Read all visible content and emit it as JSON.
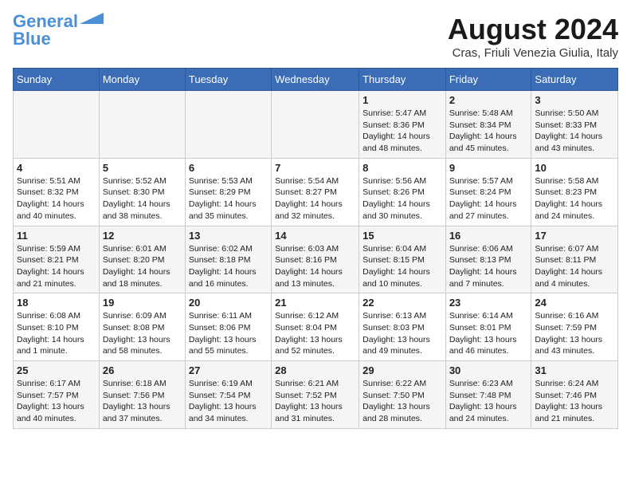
{
  "header": {
    "logo_line1": "General",
    "logo_line2": "Blue",
    "month_title": "August 2024",
    "location": "Cras, Friuli Venezia Giulia, Italy"
  },
  "days_of_week": [
    "Sunday",
    "Monday",
    "Tuesday",
    "Wednesday",
    "Thursday",
    "Friday",
    "Saturday"
  ],
  "weeks": [
    [
      {
        "day": "",
        "info": ""
      },
      {
        "day": "",
        "info": ""
      },
      {
        "day": "",
        "info": ""
      },
      {
        "day": "",
        "info": ""
      },
      {
        "day": "1",
        "info": "Sunrise: 5:47 AM\nSunset: 8:36 PM\nDaylight: 14 hours\nand 48 minutes."
      },
      {
        "day": "2",
        "info": "Sunrise: 5:48 AM\nSunset: 8:34 PM\nDaylight: 14 hours\nand 45 minutes."
      },
      {
        "day": "3",
        "info": "Sunrise: 5:50 AM\nSunset: 8:33 PM\nDaylight: 14 hours\nand 43 minutes."
      }
    ],
    [
      {
        "day": "4",
        "info": "Sunrise: 5:51 AM\nSunset: 8:32 PM\nDaylight: 14 hours\nand 40 minutes."
      },
      {
        "day": "5",
        "info": "Sunrise: 5:52 AM\nSunset: 8:30 PM\nDaylight: 14 hours\nand 38 minutes."
      },
      {
        "day": "6",
        "info": "Sunrise: 5:53 AM\nSunset: 8:29 PM\nDaylight: 14 hours\nand 35 minutes."
      },
      {
        "day": "7",
        "info": "Sunrise: 5:54 AM\nSunset: 8:27 PM\nDaylight: 14 hours\nand 32 minutes."
      },
      {
        "day": "8",
        "info": "Sunrise: 5:56 AM\nSunset: 8:26 PM\nDaylight: 14 hours\nand 30 minutes."
      },
      {
        "day": "9",
        "info": "Sunrise: 5:57 AM\nSunset: 8:24 PM\nDaylight: 14 hours\nand 27 minutes."
      },
      {
        "day": "10",
        "info": "Sunrise: 5:58 AM\nSunset: 8:23 PM\nDaylight: 14 hours\nand 24 minutes."
      }
    ],
    [
      {
        "day": "11",
        "info": "Sunrise: 5:59 AM\nSunset: 8:21 PM\nDaylight: 14 hours\nand 21 minutes."
      },
      {
        "day": "12",
        "info": "Sunrise: 6:01 AM\nSunset: 8:20 PM\nDaylight: 14 hours\nand 18 minutes."
      },
      {
        "day": "13",
        "info": "Sunrise: 6:02 AM\nSunset: 8:18 PM\nDaylight: 14 hours\nand 16 minutes."
      },
      {
        "day": "14",
        "info": "Sunrise: 6:03 AM\nSunset: 8:16 PM\nDaylight: 14 hours\nand 13 minutes."
      },
      {
        "day": "15",
        "info": "Sunrise: 6:04 AM\nSunset: 8:15 PM\nDaylight: 14 hours\nand 10 minutes."
      },
      {
        "day": "16",
        "info": "Sunrise: 6:06 AM\nSunset: 8:13 PM\nDaylight: 14 hours\nand 7 minutes."
      },
      {
        "day": "17",
        "info": "Sunrise: 6:07 AM\nSunset: 8:11 PM\nDaylight: 14 hours\nand 4 minutes."
      }
    ],
    [
      {
        "day": "18",
        "info": "Sunrise: 6:08 AM\nSunset: 8:10 PM\nDaylight: 14 hours\nand 1 minute."
      },
      {
        "day": "19",
        "info": "Sunrise: 6:09 AM\nSunset: 8:08 PM\nDaylight: 13 hours\nand 58 minutes."
      },
      {
        "day": "20",
        "info": "Sunrise: 6:11 AM\nSunset: 8:06 PM\nDaylight: 13 hours\nand 55 minutes."
      },
      {
        "day": "21",
        "info": "Sunrise: 6:12 AM\nSunset: 8:04 PM\nDaylight: 13 hours\nand 52 minutes."
      },
      {
        "day": "22",
        "info": "Sunrise: 6:13 AM\nSunset: 8:03 PM\nDaylight: 13 hours\nand 49 minutes."
      },
      {
        "day": "23",
        "info": "Sunrise: 6:14 AM\nSunset: 8:01 PM\nDaylight: 13 hours\nand 46 minutes."
      },
      {
        "day": "24",
        "info": "Sunrise: 6:16 AM\nSunset: 7:59 PM\nDaylight: 13 hours\nand 43 minutes."
      }
    ],
    [
      {
        "day": "25",
        "info": "Sunrise: 6:17 AM\nSunset: 7:57 PM\nDaylight: 13 hours\nand 40 minutes."
      },
      {
        "day": "26",
        "info": "Sunrise: 6:18 AM\nSunset: 7:56 PM\nDaylight: 13 hours\nand 37 minutes."
      },
      {
        "day": "27",
        "info": "Sunrise: 6:19 AM\nSunset: 7:54 PM\nDaylight: 13 hours\nand 34 minutes."
      },
      {
        "day": "28",
        "info": "Sunrise: 6:21 AM\nSunset: 7:52 PM\nDaylight: 13 hours\nand 31 minutes."
      },
      {
        "day": "29",
        "info": "Sunrise: 6:22 AM\nSunset: 7:50 PM\nDaylight: 13 hours\nand 28 minutes."
      },
      {
        "day": "30",
        "info": "Sunrise: 6:23 AM\nSunset: 7:48 PM\nDaylight: 13 hours\nand 24 minutes."
      },
      {
        "day": "31",
        "info": "Sunrise: 6:24 AM\nSunset: 7:46 PM\nDaylight: 13 hours\nand 21 minutes."
      }
    ]
  ]
}
